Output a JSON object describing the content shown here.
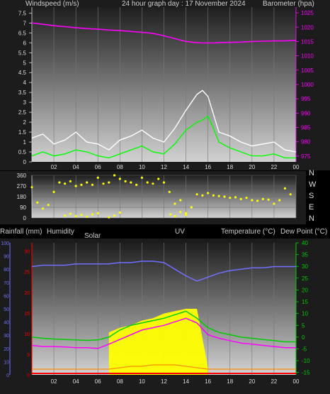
{
  "header": {
    "windspeed_label": "Windspeed (m/s)",
    "graph_title": "24 hour graph day : 17 November 2024",
    "barometer_label": "Barometer (hpa)"
  },
  "compass_labels": [
    "N",
    "W",
    "S",
    "E",
    "N"
  ],
  "bottom_header": {
    "rainfall_label": "Rainfall (mm)",
    "humidity_label": "Humidity",
    "solar_label": "Solar",
    "uv_label": "UV",
    "temperature_label": "Temperature (°C)",
    "dewpoint_label": "Dew Point (°C)"
  },
  "colors": {
    "wind_avg": "#00ff00",
    "wind_gust": "#ffffff",
    "barometer": "#ff00ff",
    "direction": "#ffff00",
    "humidity": "#7070ff",
    "solar": "#ffff00",
    "uv": "#ff8c00",
    "temperature": "#00cc00",
    "dewpoint": "#ff00ff",
    "rain_axis": "#ff0000"
  },
  "chart_data": [
    {
      "type": "line",
      "xlabel": "",
      "x_ticks": [
        "02",
        "04",
        "06",
        "08",
        "10",
        "12",
        "14",
        "16",
        "18",
        "20",
        "22",
        "00"
      ],
      "y_left_label": "Windspeed (m/s)",
      "y_left_ticks": [
        "0",
        "0.5",
        "1",
        "1.5",
        "2",
        "2.5",
        "3",
        "3.5",
        "4",
        "4.5",
        "5",
        "5.5",
        "6",
        "6.5",
        "7",
        "7.5"
      ],
      "y_left_range": [
        0,
        7.8
      ],
      "y_right_label": "Barometer (hpa)",
      "y_right_ticks": [
        "975",
        "980",
        "985",
        "990",
        "995",
        "1000",
        "1005",
        "1010",
        "1015",
        "1020",
        "1025"
      ],
      "y_right_range": [
        973,
        1027
      ],
      "hours": [
        0,
        1,
        2,
        3,
        4,
        5,
        6,
        7,
        8,
        9,
        10,
        11,
        12,
        13,
        14,
        15,
        15.5,
        16,
        16.5,
        17,
        18,
        19,
        20,
        21,
        22,
        23,
        24
      ],
      "series": [
        {
          "name": "Barometer",
          "axis": "right",
          "values": [
            1021.5,
            1021,
            1020.5,
            1020.2,
            1019.8,
            1019.5,
            1019.3,
            1019,
            1018.8,
            1018.5,
            1018.2,
            1017.8,
            1017,
            1016,
            1015,
            1014.6,
            1014.5,
            1014.5,
            1014.5,
            1014.6,
            1014.7,
            1014.8,
            1015,
            1015.1,
            1015.2,
            1015.2,
            1015.4
          ]
        },
        {
          "name": "Wind average",
          "axis": "left",
          "values": [
            0.3,
            0.5,
            0.3,
            0.4,
            0.6,
            0.5,
            0.3,
            0.2,
            0.4,
            0.6,
            0.8,
            0.5,
            0.4,
            0.9,
            1.6,
            2.0,
            2.1,
            2.3,
            1.7,
            1.0,
            0.7,
            0.5,
            0.3,
            0.3,
            0.4,
            0.2,
            0.2
          ]
        },
        {
          "name": "Wind gust",
          "axis": "left",
          "values": [
            1.2,
            1.4,
            0.9,
            1.1,
            1.5,
            1.0,
            0.9,
            0.6,
            1.1,
            1.3,
            1.6,
            1.2,
            1.0,
            1.7,
            2.6,
            3.4,
            3.6,
            3.3,
            2.4,
            1.5,
            1.3,
            1.0,
            0.8,
            0.9,
            1.0,
            0.6,
            0.5
          ]
        }
      ]
    },
    {
      "type": "scatter",
      "y_ticks": [
        "0",
        "90",
        "180",
        "270",
        "360"
      ],
      "y_range": [
        0,
        360
      ],
      "series": [
        {
          "name": "Wind direction",
          "hours": [
            0,
            0.5,
            1,
            1.5,
            2,
            2.5,
            3,
            3.5,
            4,
            4.5,
            5,
            5.5,
            6,
            6.5,
            7,
            7.5,
            8,
            8.5,
            9,
            9.5,
            10,
            10.5,
            11,
            11.5,
            12,
            12.5,
            13,
            13.5,
            14,
            14.5,
            15,
            15.5,
            16,
            16.5,
            17,
            17.5,
            18,
            18.5,
            19,
            19.5,
            20,
            20.5,
            21,
            21.5,
            22,
            22.5,
            23,
            23.5
          ],
          "values": [
            260,
            130,
            80,
            110,
            220,
            300,
            290,
            310,
            270,
            280,
            300,
            280,
            340,
            290,
            300,
            360,
            330,
            310,
            300,
            280,
            340,
            300,
            290,
            330,
            300,
            220,
            120,
            150,
            40,
            90,
            200,
            190,
            210,
            190,
            185,
            180,
            170,
            175,
            160,
            170,
            150,
            145,
            160,
            155,
            120,
            150,
            250,
            200
          ]
        },
        {
          "name": "Wind direction (low)",
          "hours": [
            3,
            3.5,
            4,
            4.5,
            5,
            5.5,
            6,
            7,
            7.5,
            8,
            12.6,
            13,
            13.5,
            14
          ],
          "values": [
            20,
            35,
            15,
            25,
            10,
            30,
            40,
            5,
            20,
            45,
            30,
            15,
            50,
            25
          ]
        }
      ]
    },
    {
      "type": "area",
      "x_ticks": [
        "02",
        "04",
        "06",
        "08",
        "10",
        "12",
        "14",
        "16",
        "18",
        "20",
        "22",
        "00"
      ],
      "rain_ticks": [
        "0",
        "5",
        "10",
        "15",
        "20",
        "25",
        "30"
      ],
      "humidity_ticks": [
        "0",
        "10",
        "20",
        "30",
        "40",
        "50",
        "60",
        "70",
        "80",
        "90",
        "100"
      ],
      "temp_ticks": [
        "-15",
        "-10",
        "-5",
        "0",
        "5",
        "10",
        "15",
        "20",
        "25",
        "30",
        "35",
        "40"
      ],
      "temp_range": [
        -16,
        40
      ],
      "hours": [
        0,
        1,
        2,
        3,
        4,
        5,
        6,
        7,
        8,
        9,
        10,
        11,
        12,
        13,
        14,
        15,
        16,
        17,
        18,
        19,
        20,
        21,
        22,
        23,
        24
      ],
      "series": [
        {
          "name": "Humidity",
          "axis": "humidity",
          "values": [
            82,
            83,
            83,
            83,
            84,
            84,
            84,
            84,
            85,
            85,
            86,
            86,
            85,
            80,
            75,
            71,
            74,
            77,
            79,
            80,
            81,
            81,
            82,
            82,
            82
          ]
        },
        {
          "name": "Temperature",
          "axis": "temp",
          "values": [
            0,
            -0.5,
            -0.8,
            -1,
            -1.2,
            -1.4,
            -1.2,
            0,
            3,
            5,
            6,
            7,
            8,
            9.5,
            11,
            8,
            4,
            2,
            1,
            0,
            -0.5,
            -1,
            -1.5,
            -2,
            -2
          ]
        },
        {
          "name": "Dew Point",
          "axis": "temp",
          "values": [
            -3.5,
            -4,
            -4,
            -4.2,
            -4.5,
            -4.5,
            -4.8,
            -3,
            -1,
            1,
            3,
            4,
            5,
            6.5,
            8,
            6,
            1,
            -0.5,
            -1.5,
            -2.5,
            -3,
            -3.5,
            -4,
            -4.5,
            -4.5
          ]
        },
        {
          "name": "Solar",
          "axis": "temp",
          "values": [
            null,
            null,
            null,
            null,
            null,
            null,
            null,
            2,
            4,
            5,
            7,
            8,
            10,
            11,
            12,
            12,
            -13,
            null,
            null,
            null,
            null,
            null,
            null,
            null,
            null
          ]
        },
        {
          "name": "UV",
          "axis": "rain",
          "values": [
            0,
            0,
            0,
            0,
            0,
            0,
            0,
            0,
            0.5,
            1,
            1,
            1.5,
            1.5,
            1.5,
            1,
            0.5,
            0,
            0,
            0,
            0,
            0,
            0,
            0,
            0,
            0
          ]
        },
        {
          "name": "Rainfall",
          "axis": "rain",
          "values": [
            0,
            0,
            0,
            0,
            0,
            0,
            0,
            0,
            0,
            0,
            0,
            0,
            0,
            0,
            0,
            0,
            0,
            0,
            0,
            0,
            0,
            0,
            0,
            0,
            0
          ]
        }
      ]
    }
  ]
}
